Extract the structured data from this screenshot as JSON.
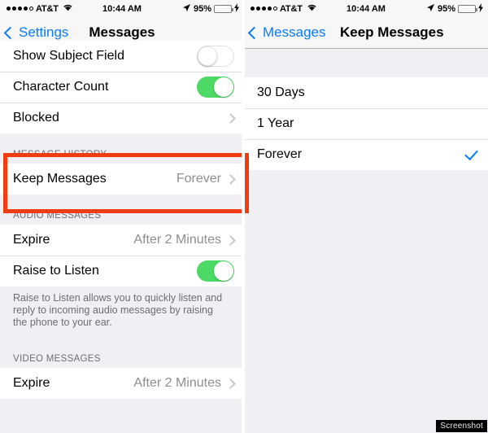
{
  "status_bar": {
    "carrier": "AT&T",
    "signal_dots_filled": 4,
    "signal_dots_total": 5,
    "wifi_icon": "wifi-icon",
    "time": "10:44 AM",
    "location_icon": "location-arrow-icon",
    "battery_percent": "95%",
    "battery_level": 95,
    "charging": true
  },
  "left_panel": {
    "nav": {
      "back_label": "Settings",
      "title": "Messages"
    },
    "sections": [
      {
        "header": "",
        "rows": [
          {
            "label": "Show Subject Field",
            "control": "toggle",
            "toggle_on": false,
            "clipped": true
          },
          {
            "label": "Character Count",
            "control": "toggle",
            "toggle_on": true
          },
          {
            "label": "Blocked",
            "control": "chevron"
          }
        ]
      },
      {
        "header": "MESSAGE HISTORY",
        "highlighted": true,
        "rows": [
          {
            "label": "Keep Messages",
            "value": "Forever",
            "control": "chevron"
          }
        ]
      },
      {
        "header": "AUDIO MESSAGES",
        "rows": [
          {
            "label": "Expire",
            "value": "After 2 Minutes",
            "control": "chevron"
          },
          {
            "label": "Raise to Listen",
            "control": "toggle",
            "toggle_on": true
          }
        ],
        "footer": "Raise to Listen allows you to quickly listen and reply to incoming audio messages by raising the phone to your ear."
      },
      {
        "header": "VIDEO MESSAGES",
        "rows": [
          {
            "label": "Expire",
            "value": "After 2 Minutes",
            "control": "chevron"
          }
        ]
      }
    ]
  },
  "right_panel": {
    "nav": {
      "back_label": "Messages",
      "title": "Keep Messages"
    },
    "options": [
      {
        "label": "30 Days",
        "selected": false
      },
      {
        "label": "1 Year",
        "selected": false
      },
      {
        "label": "Forever",
        "selected": true
      }
    ]
  },
  "watermark": {
    "label": "Screenshot"
  },
  "colors": {
    "accent_blue": "#0a7bf2",
    "toggle_green": "#4cd964",
    "highlight_red": "#f03c10",
    "group_background": "#efeff4",
    "row_background": "#ffffff",
    "secondary_text": "#8e8e93"
  }
}
